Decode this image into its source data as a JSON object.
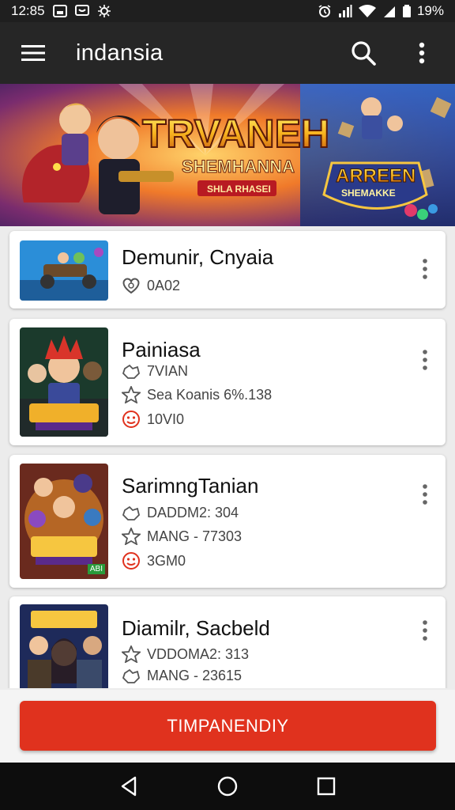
{
  "status_bar": {
    "time": "12:85",
    "battery": "19%",
    "icons_left": [
      "image-icon",
      "message-icon",
      "settings-icon"
    ],
    "icons_right": [
      "alarm-icon",
      "signal-icon",
      "wifi-icon",
      "battery-icon"
    ]
  },
  "app_bar": {
    "title": "indansia",
    "menu_icon": "menu-icon",
    "search_icon": "search-icon",
    "more_icon": "more-vert-icon"
  },
  "banner": {
    "headline": "TRVANEH",
    "subtitle": "SHEMHANNA",
    "ribbon": "SHLA RHASEI",
    "badge_title": "ARREEN",
    "badge_subtitle": "SHEMAKKE"
  },
  "games": [
    {
      "title": "Demunir, Cnyaia",
      "meta": [
        {
          "icon": "heart-icon",
          "text": "0A02"
        }
      ]
    },
    {
      "title": "Painiasa",
      "meta": [
        {
          "icon": "controller-icon",
          "text": "7VIAN"
        },
        {
          "icon": "star-icon",
          "text": "Sea Koanis 6%.138"
        },
        {
          "icon": "face-icon",
          "text": "10VI0"
        }
      ]
    },
    {
      "title": "SarimngTanian",
      "meta": [
        {
          "icon": "controller-icon",
          "text": "DADDM2: 304"
        },
        {
          "icon": "star-icon",
          "text": "MANG - 77303"
        },
        {
          "icon": "face-icon",
          "text": "3GM0"
        }
      ],
      "thumb_tag": "ABI"
    },
    {
      "title": "Diamilr, Sacbeld",
      "meta": [
        {
          "icon": "star-icon",
          "text": "VDDOMA2: 313"
        },
        {
          "icon": "controller-icon",
          "text": "MANG - 23615"
        }
      ]
    }
  ],
  "primary_action": {
    "label": "TIMPANENDIY"
  },
  "colors": {
    "status_bar": "#1f1f1f",
    "app_bar": "#262626",
    "accent": "#e0321e",
    "background": "#ececec",
    "nav_bar": "#0d0d0d"
  }
}
